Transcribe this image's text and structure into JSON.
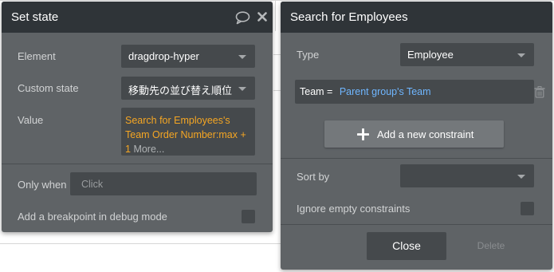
{
  "set_state": {
    "title": "Set state",
    "element_label": "Element",
    "element_value": "dragdrop-hyper",
    "custom_state_label": "Custom state",
    "custom_state_value": "移動先の並び替え順位",
    "value_label": "Value",
    "value_expr_line1": "Search for Employees's",
    "value_expr_line2": "Team Order Number:max +",
    "value_expr_line3": "1",
    "value_more": "More...",
    "only_when_label": "Only when",
    "only_when_placeholder": "Click",
    "breakpoint_label": "Add a breakpoint in debug mode",
    "breakpoint_checked": false
  },
  "search": {
    "title": "Search for Employees",
    "type_label": "Type",
    "type_value": "Employee",
    "constraint_field": "Team =",
    "constraint_value": "Parent group's Team",
    "add_constraint_label": "Add a new constraint",
    "sort_by_label": "Sort by",
    "sort_by_value": "",
    "ignore_empty_label": "Ignore empty constraints",
    "ignore_empty_checked": false,
    "close_label": "Close",
    "delete_label": "Delete"
  },
  "colors": {
    "panel_bg": "#5f6366",
    "header_bg": "#2f3438",
    "field_bg": "#45494c",
    "expression_orange": "#f5a623",
    "constraint_blue": "#6fb6ff"
  }
}
